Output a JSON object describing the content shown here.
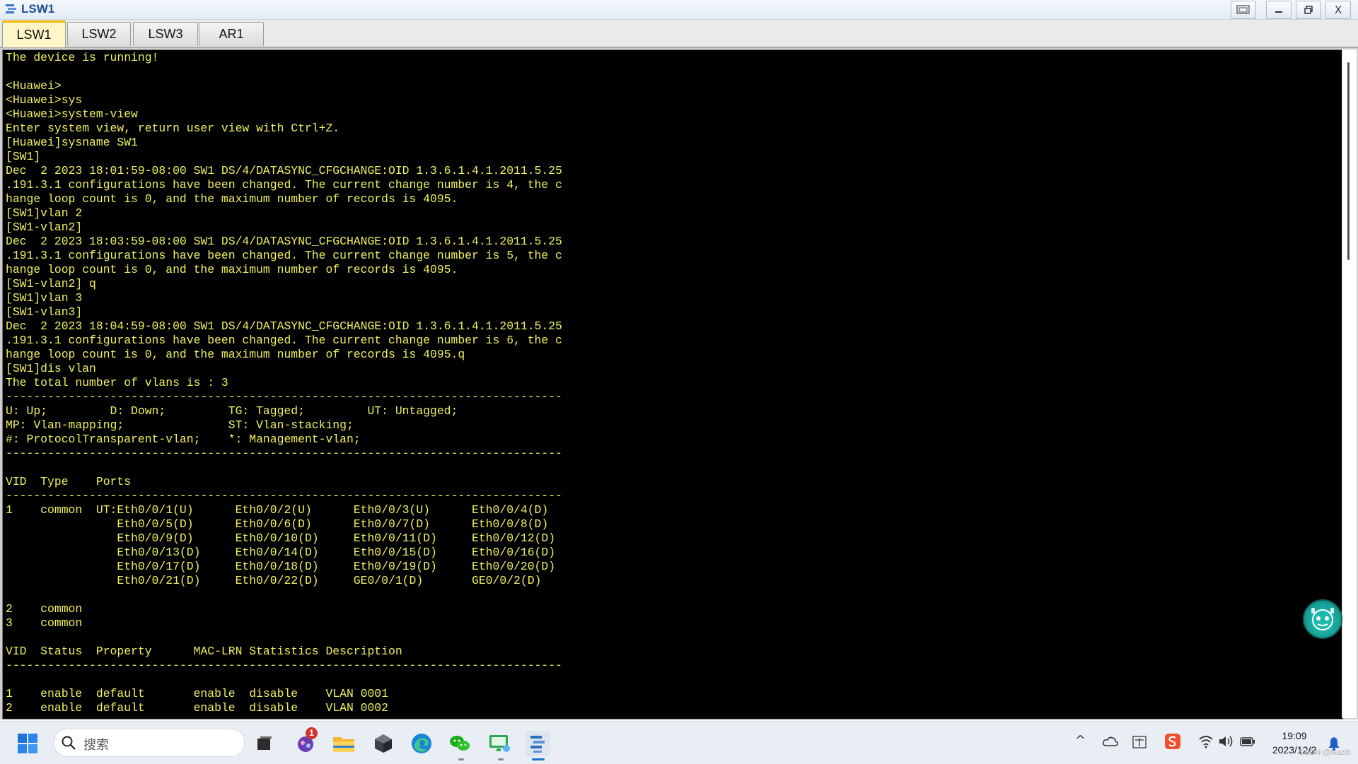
{
  "window": {
    "title": "LSW1",
    "buttons": [
      "restore-pane",
      "minimize",
      "maximize",
      "close"
    ],
    "close_label": "X"
  },
  "tabs": [
    {
      "label": "LSW1",
      "active": true
    },
    {
      "label": "LSW2",
      "active": false
    },
    {
      "label": "LSW3",
      "active": false
    },
    {
      "label": "AR1",
      "active": false
    }
  ],
  "terminal": {
    "text_color": "#f0f061",
    "background": "#000000",
    "lines": [
      "The device is running!",
      "",
      "<Huawei>",
      "<Huawei>sys",
      "<Huawei>system-view",
      "Enter system view, return user view with Ctrl+Z.",
      "[Huawei]sysname SW1",
      "[SW1]",
      "Dec  2 2023 18:01:59-08:00 SW1 DS/4/DATASYNC_CFGCHANGE:OID 1.3.6.1.4.1.2011.5.25",
      ".191.3.1 configurations have been changed. The current change number is 4, the c",
      "hange loop count is 0, and the maximum number of records is 4095.",
      "[SW1]vlan 2",
      "[SW1-vlan2]",
      "Dec  2 2023 18:03:59-08:00 SW1 DS/4/DATASYNC_CFGCHANGE:OID 1.3.6.1.4.1.2011.5.25",
      ".191.3.1 configurations have been changed. The current change number is 5, the c",
      "hange loop count is 0, and the maximum number of records is 4095.",
      "[SW1-vlan2] q",
      "[SW1]vlan 3",
      "[SW1-vlan3]",
      "Dec  2 2023 18:04:59-08:00 SW1 DS/4/DATASYNC_CFGCHANGE:OID 1.3.6.1.4.1.2011.5.25",
      ".191.3.1 configurations have been changed. The current change number is 6, the c",
      "hange loop count is 0, and the maximum number of records is 4095.q",
      "[SW1]dis vlan",
      "The total number of vlans is : 3",
      "--------------------------------------------------------------------------------",
      "U: Up;         D: Down;         TG: Tagged;         UT: Untagged;",
      "MP: Vlan-mapping;               ST: Vlan-stacking;",
      "#: ProtocolTransparent-vlan;    *: Management-vlan;",
      "--------------------------------------------------------------------------------",
      "",
      "VID  Type    Ports",
      "--------------------------------------------------------------------------------",
      "1    common  UT:Eth0/0/1(U)      Eth0/0/2(U)      Eth0/0/3(U)      Eth0/0/4(D)",
      "                Eth0/0/5(D)      Eth0/0/6(D)      Eth0/0/7(D)      Eth0/0/8(D)",
      "                Eth0/0/9(D)      Eth0/0/10(D)     Eth0/0/11(D)     Eth0/0/12(D)",
      "                Eth0/0/13(D)     Eth0/0/14(D)     Eth0/0/15(D)     Eth0/0/16(D)",
      "                Eth0/0/17(D)     Eth0/0/18(D)     Eth0/0/19(D)     Eth0/0/20(D)",
      "                Eth0/0/21(D)     Eth0/0/22(D)     GE0/0/1(D)       GE0/0/2(D)",
      "",
      "2    common",
      "3    common",
      "",
      "VID  Status  Property      MAC-LRN Statistics Description",
      "--------------------------------------------------------------------------------",
      "",
      "1    enable  default       enable  disable    VLAN 0001",
      "2    enable  default       enable  disable    VLAN 0002"
    ]
  },
  "taskbar": {
    "search_placeholder": "搜索",
    "notification_badge": "1",
    "apps": [
      "task-view",
      "app-with-badge",
      "file-explorer",
      "3d-box-app",
      "edge-browser",
      "wechat",
      "remote-desktop",
      "ensp"
    ],
    "tray": [
      "chevron-up",
      "cloud",
      "ime",
      "sogou",
      "wifi",
      "volume",
      "battery",
      "bell"
    ],
    "time": "19:09",
    "date": "2023/12/2"
  },
  "watermark": "CSDN @Nazi6"
}
